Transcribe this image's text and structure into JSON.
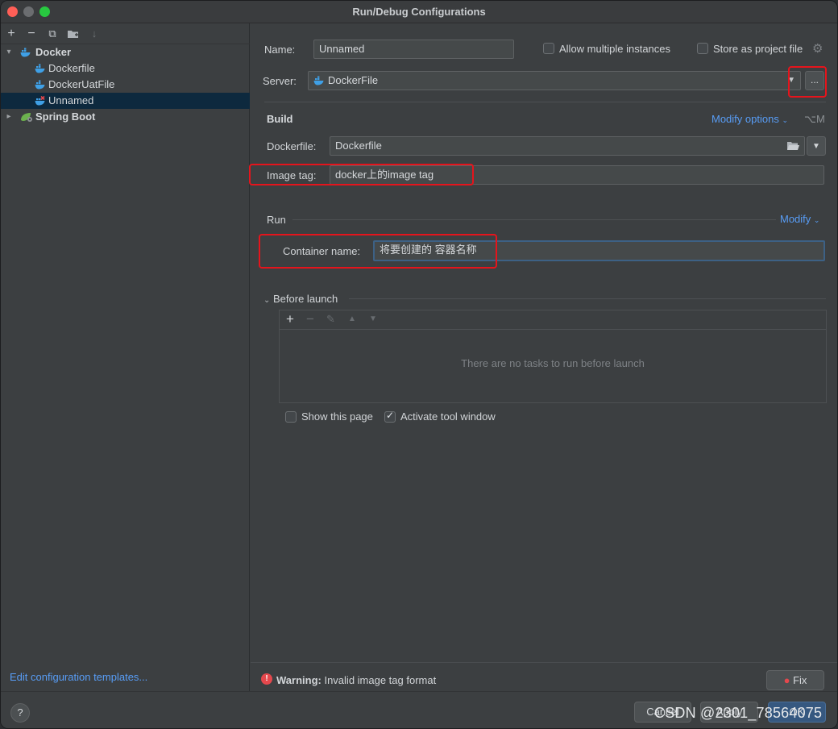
{
  "window": {
    "title": "Run/Debug Configurations"
  },
  "left_toolbar": {
    "add": "+",
    "remove": "−",
    "copy": "⧉",
    "folder": "▸",
    "sort": "↓"
  },
  "tree": {
    "docker": {
      "label": "Docker"
    },
    "children": [
      {
        "label": "Dockerfile"
      },
      {
        "label": "DockerUatFile"
      },
      {
        "label": "Unnamed"
      }
    ],
    "spring_boot": {
      "label": "Spring Boot"
    }
  },
  "left_footer": {
    "edit_templates": "Edit configuration templates..."
  },
  "config": {
    "name_label": "Name:",
    "name_value": "Unnamed",
    "allow_multiple_label": "Allow multiple instances",
    "allow_multiple_checked": false,
    "store_project_label": "Store as project file",
    "store_project_checked": false,
    "server_label": "Server:",
    "server_value": "DockerFile",
    "server_more": "..."
  },
  "build": {
    "title": "Build",
    "modify_options": "Modify options",
    "modify_shortcut": "⌥M",
    "dockerfile_label": "Dockerfile:",
    "dockerfile_value": "Dockerfile",
    "image_tag_label": "Image tag:",
    "image_tag_value": "docker上的image tag"
  },
  "run": {
    "title": "Run",
    "modify": "Modify",
    "container_name_label": "Container name:",
    "container_name_value": "将要创建的 容器名称"
  },
  "before_launch": {
    "title": "Before launch",
    "empty_text": "There are no tasks to run before launch",
    "show_page_label": "Show this page",
    "show_page_checked": false,
    "activate_tool_label": "Activate tool window",
    "activate_tool_checked": true
  },
  "warning": {
    "prefix": "Warning:",
    "message": "Invalid image tag format",
    "fix": "Fix"
  },
  "bottom": {
    "help": "?",
    "cancel": "Cancel",
    "apply": "Apply",
    "ok": "OK"
  },
  "watermark": "CSDN @2301_78564075",
  "colors": {
    "accent": "#589df6",
    "highlight": "#e5141c",
    "selection": "#0d293e"
  }
}
